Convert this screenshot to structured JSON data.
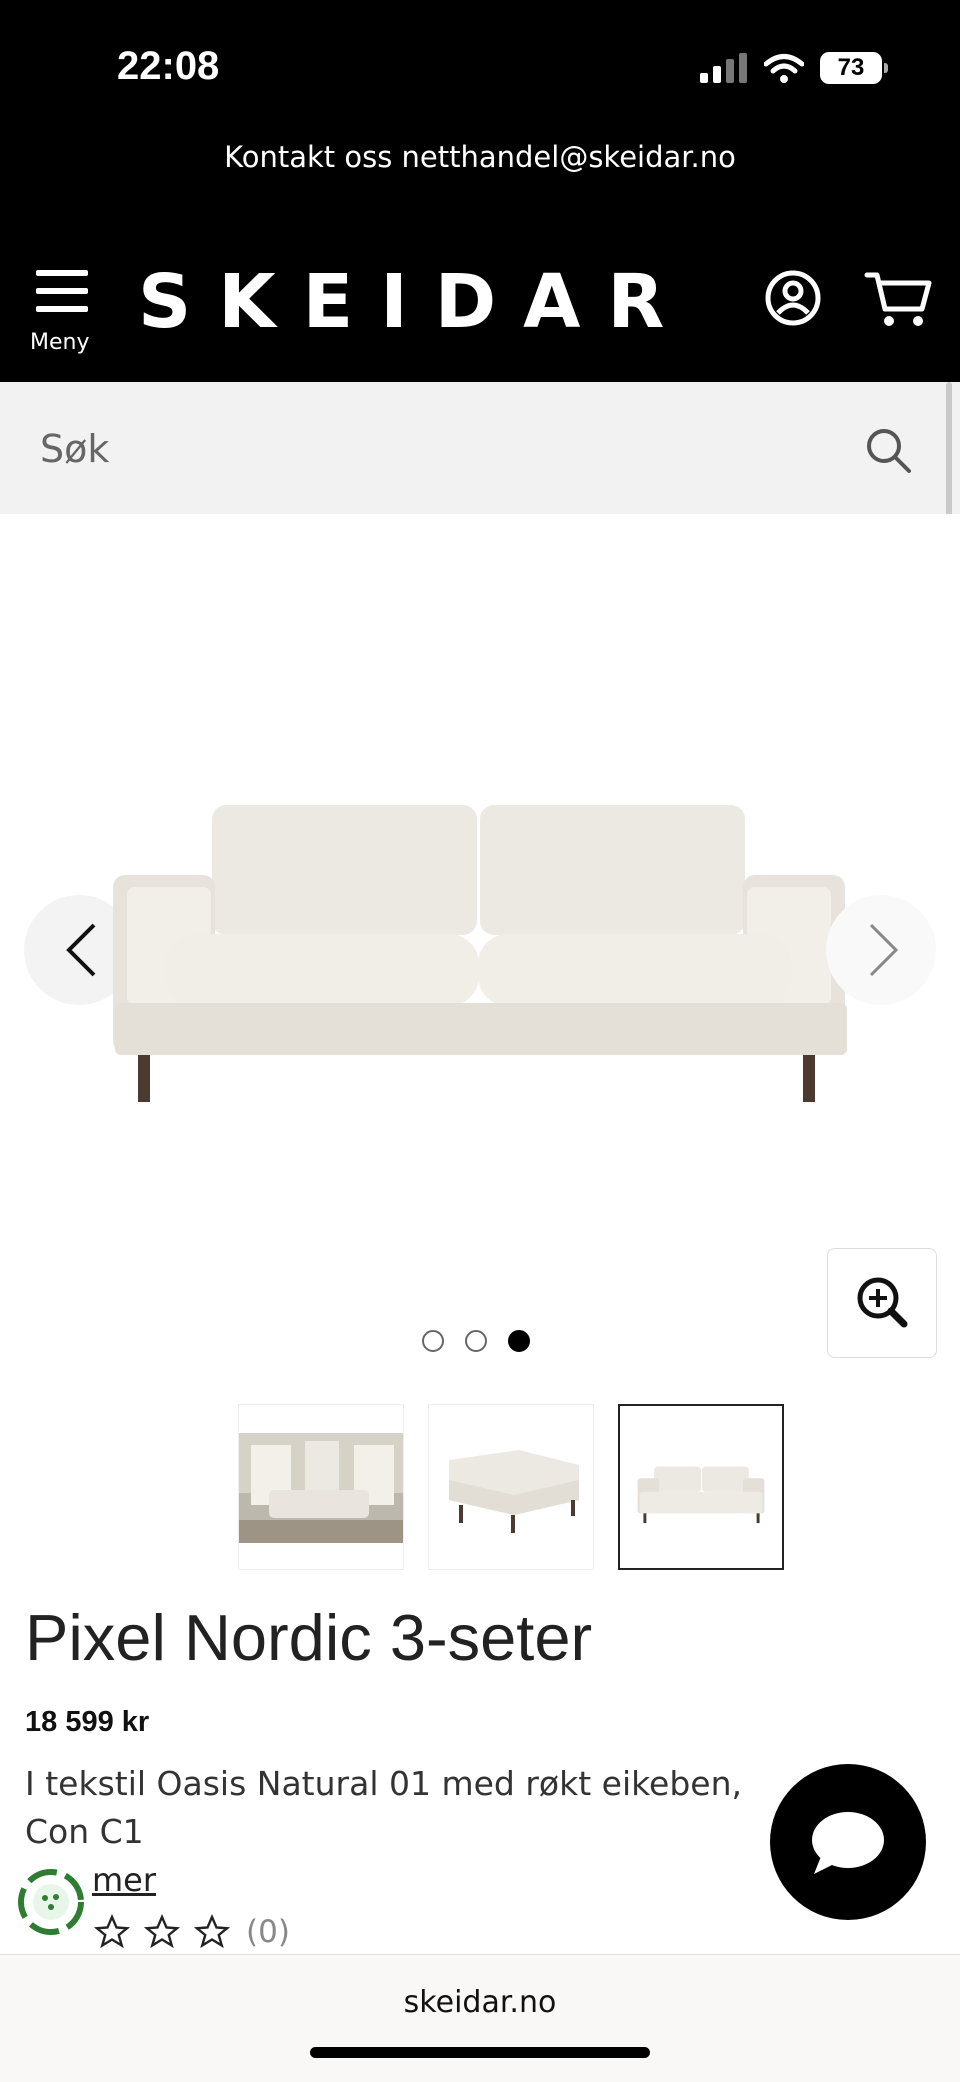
{
  "status_bar": {
    "time": "22:08",
    "battery_level": "73"
  },
  "header": {
    "contact_text": "Kontakt oss netthandel@skeidar.no",
    "menu_label": "Meny",
    "logo_text": "SKEIDAR"
  },
  "search": {
    "placeholder": "Søk"
  },
  "gallery": {
    "image_count": 3,
    "active_index": 3
  },
  "product": {
    "title": "Pixel Nordic 3-seter",
    "price": "18 599 kr",
    "description": "I tekstil Oasis Natural 01 med røkt eikeben, Con C1",
    "more_link": "mer",
    "rating_count": "(0)"
  },
  "browser": {
    "domain": "skeidar.no"
  },
  "colors": {
    "header_bg": "#000000",
    "accent": "#000000",
    "search_bg": "#f2f2f2",
    "eco_green": "#2e7d32"
  }
}
